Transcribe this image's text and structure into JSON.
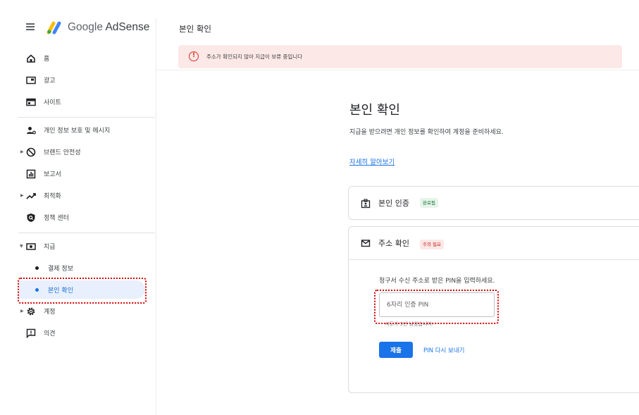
{
  "header": {
    "brand": "Google AdSense",
    "brand_google": "Google",
    "brand_product": "AdSense",
    "page_heading": "본인 확인",
    "icons": {
      "menu": "hamburger-menu-icon",
      "logo": "adsense-logo-icon"
    }
  },
  "sidebar": {
    "items": [
      {
        "label": "홈",
        "icon": "home-icon"
      },
      {
        "label": "광고",
        "icon": "ads-icon"
      },
      {
        "label": "사이트",
        "icon": "sites-icon"
      },
      {
        "label": "개인 정보 보호 및 메시지",
        "icon": "privacy-messaging-icon"
      },
      {
        "label": "브랜드 안전성",
        "icon": "block-icon",
        "expandable": true
      },
      {
        "label": "보고서",
        "icon": "reports-icon"
      },
      {
        "label": "최적화",
        "icon": "trending-icon",
        "expandable": true
      },
      {
        "label": "정책 센터",
        "icon": "policy-shield-icon"
      },
      {
        "label": "지급",
        "icon": "payments-icon",
        "expanded": true
      },
      {
        "label": "계정",
        "icon": "gear-icon",
        "expandable": true
      },
      {
        "label": "의견",
        "icon": "feedback-icon"
      }
    ],
    "sub_items": [
      {
        "label": "결제 정보",
        "active": false
      },
      {
        "label": "본인 확인",
        "active": true
      }
    ]
  },
  "banner": {
    "icon": "error-icon",
    "text": "주소가 확인되지 않아 지급이 보류 중입니다"
  },
  "main": {
    "title": "본인 확인",
    "description": "지급을 받으려면 개인 정보를 확인하여 계정을 준비하세요.",
    "learn_more": "자세히 알아보기"
  },
  "cards": [
    {
      "title": "본인 인증",
      "status": "완료됨",
      "status_type": "complete",
      "icon": "id-badge-icon"
    },
    {
      "title": "주소 확인",
      "status": "주의 필요",
      "status_type": "attention",
      "icon": "mail-icon",
      "instruction": "청구서 수신 주소로 받은 PIN을 입력하세요.",
      "input_placeholder": "6자리 인증 PIN",
      "input_value": "",
      "attempts_text": "시도가 3번 남았습니다.",
      "submit_label": "제출",
      "resend_label": "PIN 다시 보내기"
    }
  ],
  "colors": {
    "accent": "#1a73e8",
    "error": "#d93025",
    "banner_bg": "#fce8e6",
    "active_bg": "#e8f0fe",
    "complete_chip_bg": "#e6f4ea",
    "complete_chip_text": "#137333",
    "focus_ring": "#d50000"
  }
}
